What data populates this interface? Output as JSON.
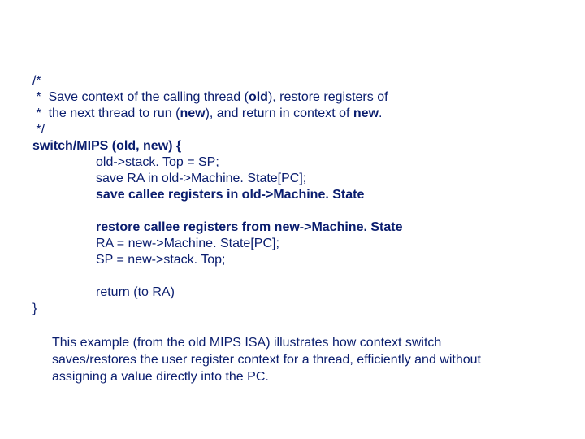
{
  "code": {
    "c1": "/*",
    "c2_pre": " *  Save context of the calling thread (",
    "c2_old": "old",
    "c2_post": "), restore registers of",
    "c3_pre": " *  the next thread to run (",
    "c3_new": "new",
    "c3_mid": "), and return in context of ",
    "c3_new2": "new",
    "c3_post": ".",
    "c4": " */",
    "func": "switch/MIPS (old, new) {",
    "l1": "old->stack. Top = SP;",
    "l2": "save RA in old->Machine. State[PC];",
    "l3": "save callee registers in old->Machine. State",
    "l4": "restore callee registers from new->Machine. State",
    "l5": "RA = new->Machine. State[PC];",
    "l6": "SP = new->stack. Top;",
    "l7": "return (to RA)",
    "close": "}"
  },
  "explain": "This example (from the old MIPS ISA) illustrates how context switch saves/restores the user register context for a thread, efficiently and without assigning a value directly into the PC."
}
